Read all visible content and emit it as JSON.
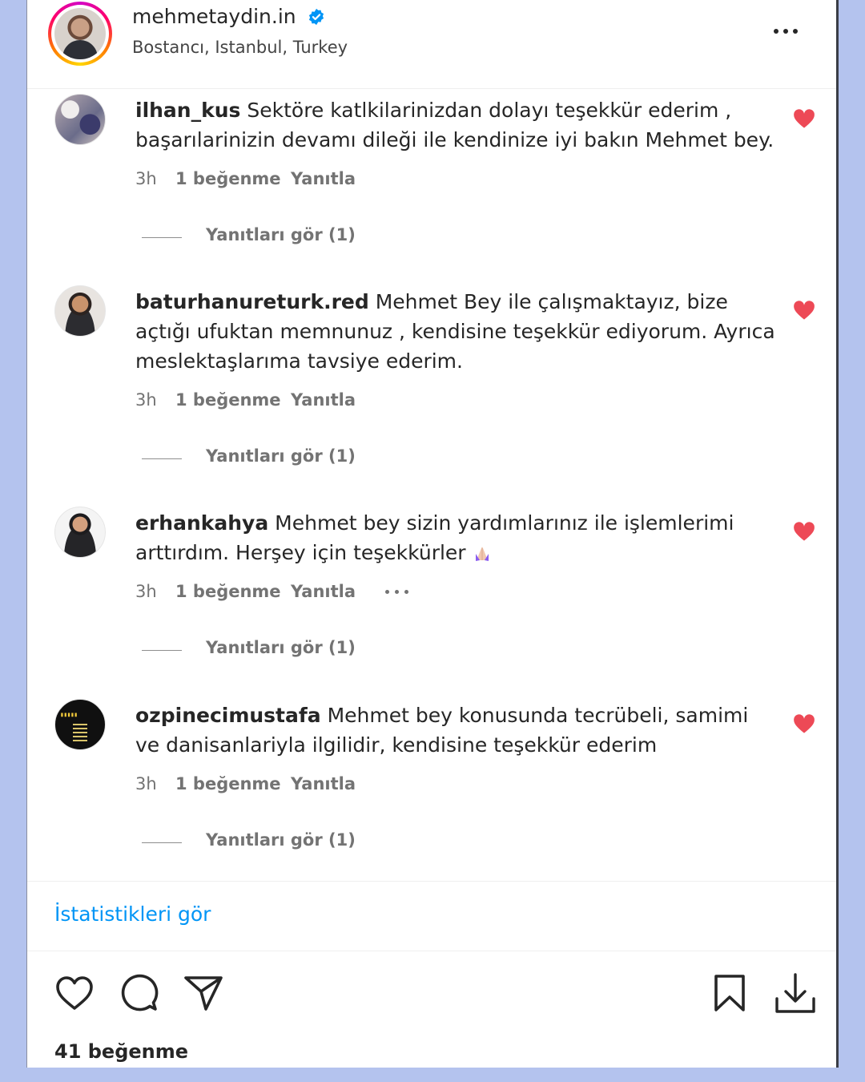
{
  "post": {
    "author": "mehmetaydin.in",
    "location": "Bostancı, Istanbul, Turkey"
  },
  "comments": [
    {
      "username": "ilhan_kus",
      "text": "Sektöre katlkilarinizdan dolayı teşekkür ederim , başarılarinizin devamı dileği ile kendinize iyi bakın Mehmet bey.",
      "time": "3h",
      "likes": "1 beğenme",
      "reply": "Yanıtla",
      "view_replies": "Yanıtları gör (1)"
    },
    {
      "username": "baturhanureturk.red",
      "text": "Mehmet Bey ile çalışmaktayız, bize açtığı ufuktan memnunuz , kendisine teşekkür ediyorum. Ayrıca meslektaşlarıma tavsiye ederim.",
      "time": "3h",
      "likes": "1 beğenme",
      "reply": "Yanıtla",
      "view_replies": "Yanıtları gör (1)"
    },
    {
      "username": "erhankahya",
      "text": "Mehmet bey sizin yardımlarınız ile işlemlerimi arttırdım. Herşey için teşekkürler",
      "time": "3h",
      "likes": "1 beğenme",
      "reply": "Yanıtla",
      "view_replies": "Yanıtları gör (1)"
    },
    {
      "username": "ozpinecimustafa",
      "text": "Mehmet bey konusunda tecrübeli, samimi ve danisanlariyla ilgilidir, kendisine teşekkür ederim",
      "time": "3h",
      "likes": "1 beğenme",
      "reply": "Yanıtla",
      "view_replies": "Yanıtları gör (1)"
    }
  ],
  "footer": {
    "stats_link": "İstatistikleri gör",
    "like_count": "41 beğenme"
  },
  "colors": {
    "heart": "#ed4956",
    "link": "#0095f6",
    "verified": "#0095f6",
    "page_background": "#b4c3ee"
  },
  "icons": {
    "verified": "verified-badge-icon",
    "more": "more-options-icon",
    "comment_like": "heart-filled-icon",
    "like": "heart-outline-icon",
    "comment": "speech-bubble-icon",
    "share": "paper-plane-icon",
    "save": "bookmark-icon",
    "download": "download-icon",
    "emoji": "folded-hands-emoji"
  }
}
